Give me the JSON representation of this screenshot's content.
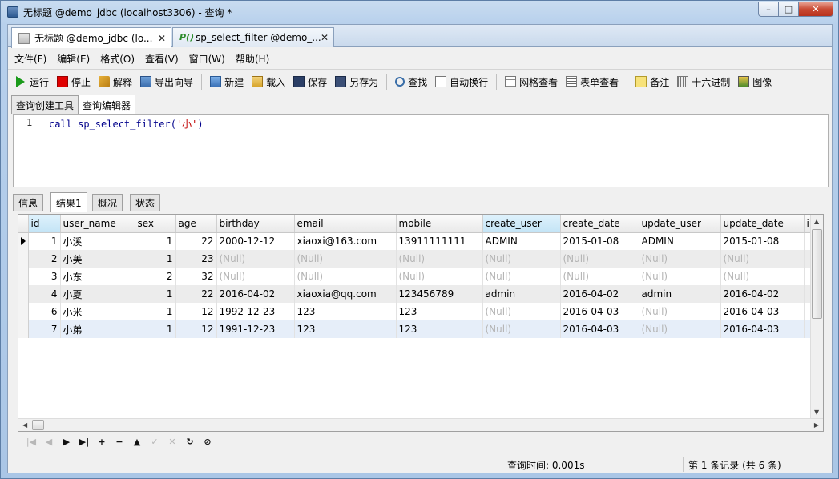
{
  "window": {
    "title": "无标题 @demo_jdbc (localhost3306) - 查询 *",
    "controls": {
      "minimize": "–",
      "maximize": "□",
      "close": "✕"
    }
  },
  "doc_tabs": [
    {
      "label": "无标题 @demo_jdbc (lo...",
      "close": "✕"
    },
    {
      "label": "sp_select_filter @demo_...",
      "close": "✕"
    }
  ],
  "menu": [
    "文件(F)",
    "编辑(E)",
    "格式(O)",
    "查看(V)",
    "窗口(W)",
    "帮助(H)"
  ],
  "toolbar": {
    "run": "运行",
    "stop": "停止",
    "explain": "解释",
    "export": "导出向导",
    "new": "新建",
    "load": "载入",
    "save": "保存",
    "saveas": "另存为",
    "find": "查找",
    "wrap": "自动换行",
    "grid_view": "网格查看",
    "form_view": "表单查看",
    "memo": "备注",
    "hex": "十六进制",
    "image": "图像"
  },
  "editor_tabs": [
    "查询创建工具",
    "查询编辑器"
  ],
  "editor": {
    "line_no": "1",
    "code_kw": "call sp_select_filter(",
    "code_str": "'小'",
    "code_end": ")"
  },
  "result_tabs": [
    "信息",
    "结果1",
    "概况",
    "状态"
  ],
  "grid": {
    "columns": [
      "id",
      "user_name",
      "sex",
      "age",
      "birthday",
      "email",
      "mobile",
      "create_user",
      "create_date",
      "update_user",
      "update_date",
      "i"
    ],
    "rows": [
      [
        "1",
        "小溪",
        "1",
        "22",
        "2000-12-12",
        "xiaoxi@163.com",
        "13911111111",
        "ADMIN",
        "2015-01-08",
        "ADMIN",
        "2015-01-08"
      ],
      [
        "2",
        "小美",
        "1",
        "23",
        "(Null)",
        "(Null)",
        "(Null)",
        "(Null)",
        "(Null)",
        "(Null)",
        "(Null)"
      ],
      [
        "3",
        "小东",
        "2",
        "32",
        "(Null)",
        "(Null)",
        "(Null)",
        "(Null)",
        "(Null)",
        "(Null)",
        "(Null)"
      ],
      [
        "4",
        "小夏",
        "1",
        "22",
        "2016-04-02",
        "xiaoxia@qq.com",
        "123456789",
        "admin",
        "2016-04-02",
        "admin",
        "2016-04-02"
      ],
      [
        "6",
        "小米",
        "1",
        "12",
        "1992-12-23",
        "123",
        "123",
        "(Null)",
        "2016-04-03",
        "(Null)",
        "2016-04-03"
      ],
      [
        "7",
        "小弟",
        "1",
        "12",
        "1991-12-23",
        "123",
        "123",
        "(Null)",
        "2016-04-03",
        "(Null)",
        "2016-04-03"
      ]
    ]
  },
  "navigator": [
    "|◀",
    "◀",
    "▶",
    "▶|",
    "+",
    "−",
    "▲",
    "✓",
    "✕",
    "↻",
    "⊘"
  ],
  "status": {
    "query_time": "查询时间: 0.001s",
    "records": "第 1 条记录 (共 6 条)"
  }
}
